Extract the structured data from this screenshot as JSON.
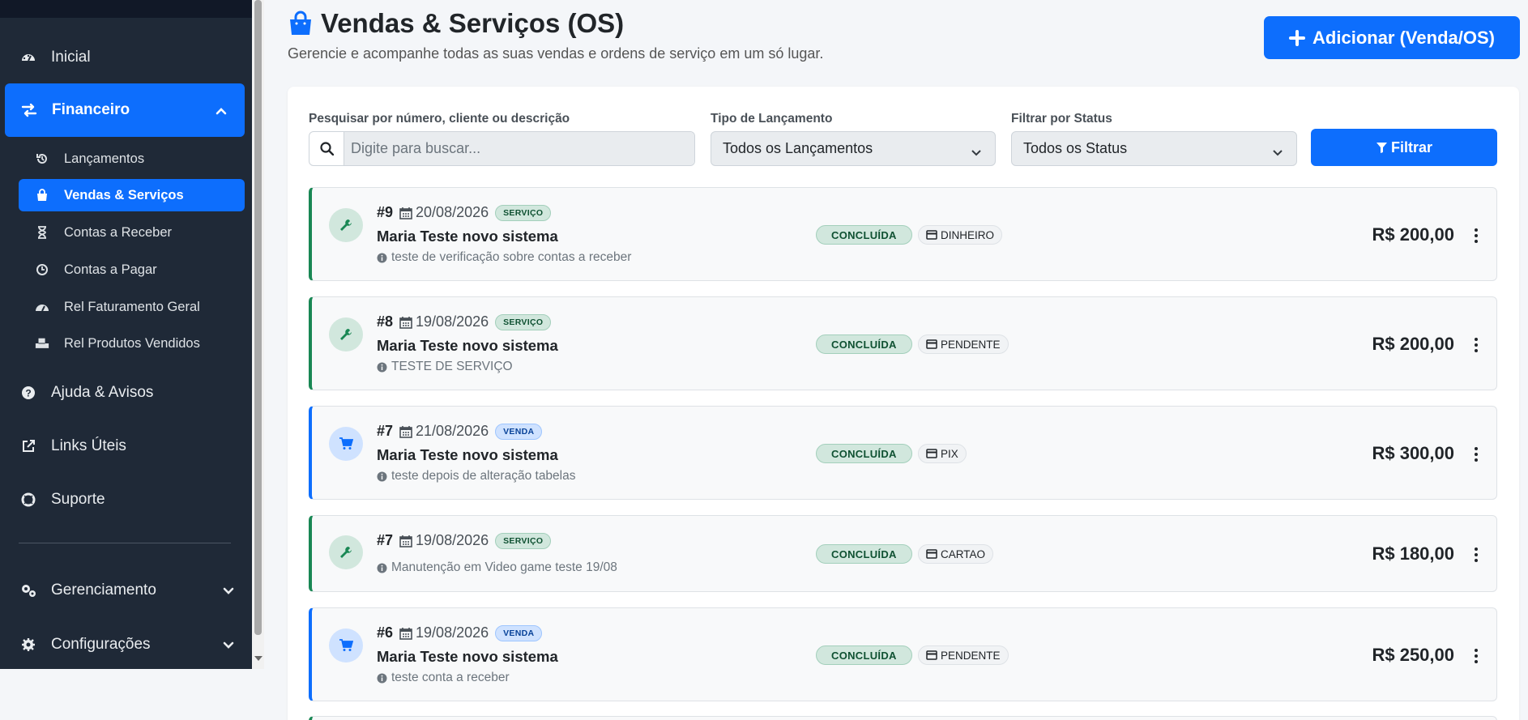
{
  "sidebar": {
    "items": [
      {
        "label": "Inicial",
        "icon": "dashboard-icon"
      },
      {
        "label": "Financeiro",
        "icon": "exchange-icon",
        "active": true
      },
      {
        "label": "Ajuda & Avisos",
        "icon": "question-icon"
      },
      {
        "label": "Links Úteis",
        "icon": "external-link-icon"
      },
      {
        "label": "Suporte",
        "icon": "lifebuoy-icon"
      },
      {
        "label": "Gerenciamento",
        "icon": "gears-icon"
      },
      {
        "label": "Configurações",
        "icon": "gear-icon"
      }
    ],
    "sub_items": [
      {
        "label": "Lançamentos",
        "icon": "history-icon"
      },
      {
        "label": "Vendas & Serviços",
        "icon": "shopping-bag-icon",
        "active": true
      },
      {
        "label": "Contas a Receber",
        "icon": "hourglass-icon"
      },
      {
        "label": "Contas a Pagar",
        "icon": "clock-icon"
      },
      {
        "label": "Rel Faturamento Geral",
        "icon": "gauge-icon"
      },
      {
        "label": "Rel Produtos Vendidos",
        "icon": "boxes-icon"
      }
    ]
  },
  "header": {
    "title": "Vendas & Serviços (OS)",
    "subtitle": "Gerencie e acompanhe todas as suas vendas e ordens de serviço em um só lugar.",
    "add_button": "Adicionar (Venda/OS)"
  },
  "filters": {
    "search_label": "Pesquisar por número, cliente ou descrição",
    "search_placeholder": "Digite para buscar...",
    "type_label": "Tipo de Lançamento",
    "type_value": "Todos os Lançamentos",
    "status_label": "Filtrar por Status",
    "status_value": "Todos os Status",
    "filter_button": "Filtrar"
  },
  "records": [
    {
      "number": "#9",
      "date": "20/08/2026",
      "type": "SERVIÇO",
      "kind": "servico",
      "client": "Maria Teste novo sistema",
      "description": "teste de verificação sobre contas a receber",
      "status": "CONCLUÍDA",
      "payment": "DINHEIRO",
      "amount": "R$ 200,00"
    },
    {
      "number": "#8",
      "date": "19/08/2026",
      "type": "SERVIÇO",
      "kind": "servico",
      "client": "Maria Teste novo sistema",
      "description": "TESTE DE SERVIÇO",
      "status": "CONCLUÍDA",
      "payment": "PENDENTE",
      "amount": "R$ 200,00"
    },
    {
      "number": "#7",
      "date": "21/08/2026",
      "type": "VENDA",
      "kind": "venda",
      "client": "Maria Teste novo sistema",
      "description": "teste depois de alteração tabelas",
      "status": "CONCLUÍDA",
      "payment": "PIX",
      "amount": "R$ 300,00"
    },
    {
      "number": "#7",
      "date": "19/08/2026",
      "type": "SERVIÇO",
      "kind": "servico",
      "client": "",
      "description": "Manutenção em Video game teste 19/08",
      "status": "CONCLUÍDA",
      "payment": "CARTAO",
      "amount": "R$ 180,00"
    },
    {
      "number": "#6",
      "date": "19/08/2026",
      "type": "VENDA",
      "kind": "venda",
      "client": "Maria Teste novo sistema",
      "description": "teste conta a receber",
      "status": "CONCLUÍDA",
      "payment": "PENDENTE",
      "amount": "R$ 250,00"
    }
  ],
  "colors": {
    "primary": "#0d6efd",
    "sidebar": "#1f2937",
    "success": "#198754"
  }
}
